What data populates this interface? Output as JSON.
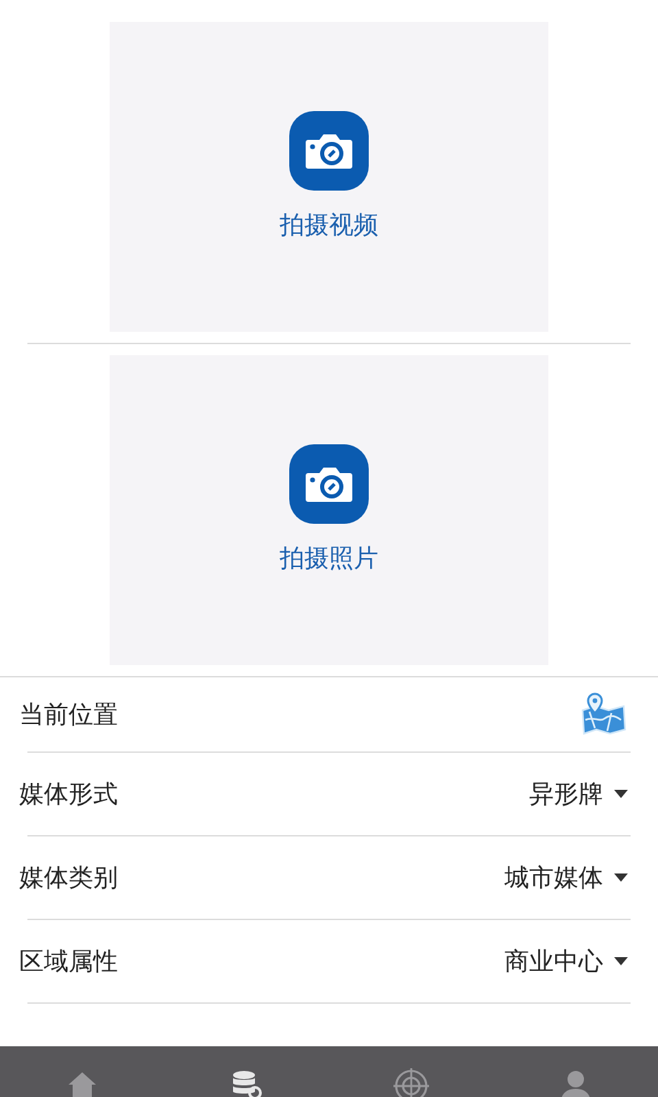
{
  "capture": [
    {
      "label": "拍摄视频"
    },
    {
      "label": "拍摄照片"
    }
  ],
  "fields": [
    {
      "kind": "location",
      "label": "当前位置"
    },
    {
      "kind": "select",
      "label": "媒体形式",
      "value": "异形牌"
    },
    {
      "kind": "select",
      "label": "媒体类别",
      "value": "城市媒体"
    },
    {
      "kind": "select",
      "label": "区域属性",
      "value": "商业中心"
    }
  ],
  "tab_bar": [
    {
      "kind": "home",
      "selected": false
    },
    {
      "kind": "database",
      "selected": true
    },
    {
      "kind": "target",
      "selected": false
    },
    {
      "kind": "person",
      "selected": false
    }
  ]
}
